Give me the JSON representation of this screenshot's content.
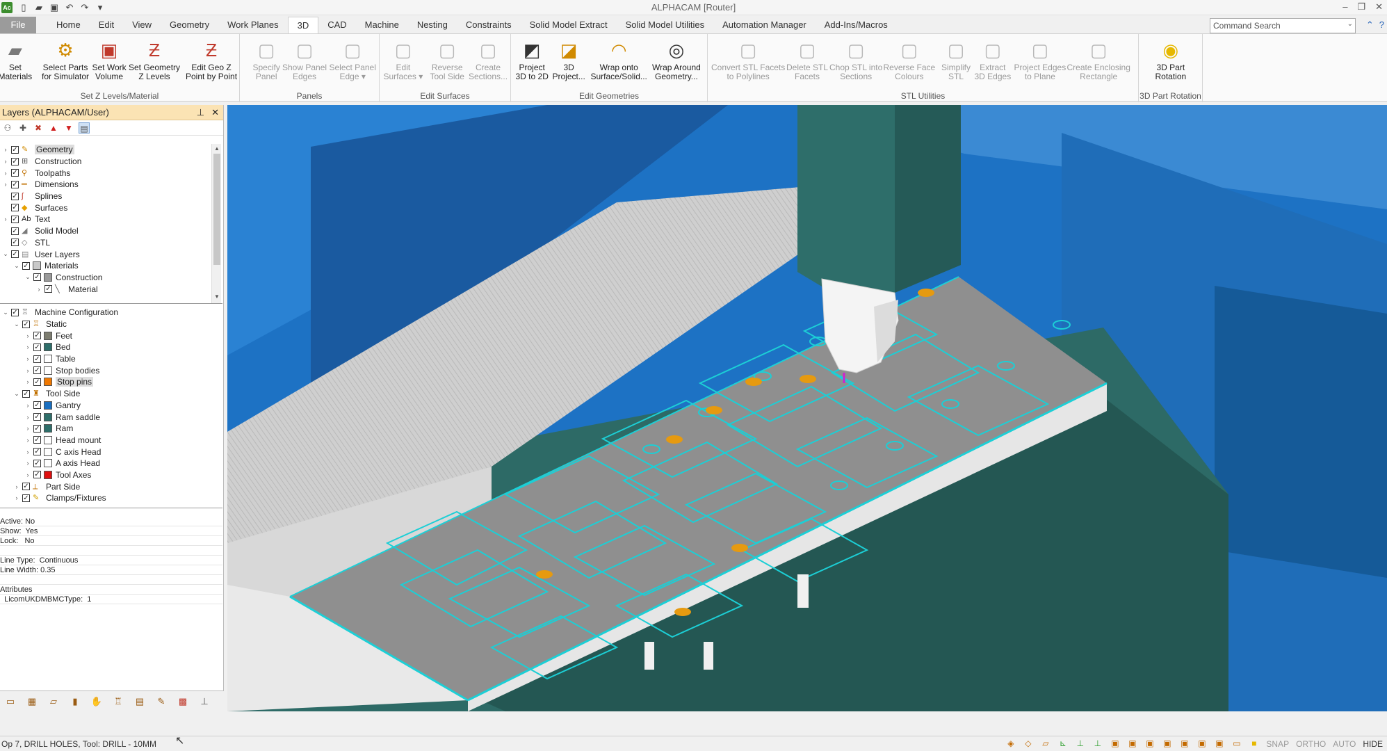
{
  "window": {
    "title": "ALPHACAM [Router]",
    "logo": "Ac"
  },
  "menu": {
    "file": "File",
    "tabs": [
      "Home",
      "Edit",
      "View",
      "Geometry",
      "Work Planes",
      "3D",
      "CAD",
      "Machine",
      "Nesting",
      "Constraints",
      "Solid Model Extract",
      "Solid Model Utilities",
      "Automation Manager",
      "Add-Ins/Macros"
    ],
    "active_tab": "3D",
    "command_search_placeholder": "Command Search"
  },
  "ribbon": {
    "groups": [
      {
        "label": "Set Z Levels/Material",
        "buttons": [
          {
            "label": "Set\nMaterials",
            "icon": "material-box-icon",
            "enabled": true
          },
          {
            "label": "Select Parts\nfor Simulator",
            "icon": "parts-simulator-icon",
            "enabled": true
          },
          {
            "label": "Set Work\nVolume",
            "icon": "work-volume-icon",
            "enabled": true
          },
          {
            "label": "Set Geometry\nZ Levels",
            "icon": "z-levels-icon",
            "enabled": true
          },
          {
            "label": "Edit Geo Z\nPoint by Point",
            "icon": "edit-z-point-icon",
            "enabled": true
          }
        ]
      },
      {
        "label": "Panels",
        "buttons": [
          {
            "label": "Specify\nPanel",
            "icon": "specify-panel-icon",
            "enabled": false
          },
          {
            "label": "Show Panel\nEdges",
            "icon": "panel-edges-icon",
            "enabled": false
          },
          {
            "label": "Select Panel\nEdge ▾",
            "icon": "select-panel-edge-icon",
            "enabled": false
          }
        ]
      },
      {
        "label": "Edit Surfaces",
        "buttons": [
          {
            "label": "Edit\nSurfaces ▾",
            "icon": "edit-surfaces-icon",
            "enabled": false
          },
          {
            "label": "Reverse\nTool Side",
            "icon": "reverse-tool-side-icon",
            "enabled": false
          },
          {
            "label": "Create\nSections...",
            "icon": "create-sections-icon",
            "enabled": false
          }
        ]
      },
      {
        "label": "Edit Geometries",
        "buttons": [
          {
            "label": "Project\n3D to 2D",
            "icon": "project-3d-2d-icon",
            "enabled": true
          },
          {
            "label": "3D\nProject...",
            "icon": "3d-project-icon",
            "enabled": true
          },
          {
            "label": "Wrap onto\nSurface/Solid...",
            "icon": "wrap-surface-icon",
            "enabled": true
          },
          {
            "label": "Wrap Around\nGeometry...",
            "icon": "wrap-geometry-icon",
            "enabled": true
          }
        ]
      },
      {
        "label": "STL Utilities",
        "buttons": [
          {
            "label": "Convert STL Facets\nto Polylines",
            "icon": "stl-polylines-icon",
            "enabled": false
          },
          {
            "label": "Delete STL\nFacets",
            "icon": "delete-stl-icon",
            "enabled": false
          },
          {
            "label": "Chop STL into\nSections",
            "icon": "chop-stl-icon",
            "enabled": false
          },
          {
            "label": "Reverse Face\nColours",
            "icon": "reverse-face-icon",
            "enabled": false
          },
          {
            "label": "Simplify\nSTL",
            "icon": "simplify-stl-icon",
            "enabled": false
          },
          {
            "label": "Extract\n3D Edges",
            "icon": "extract-edges-icon",
            "enabled": false
          },
          {
            "label": "Project Edges\nto Plane",
            "icon": "project-edges-icon",
            "enabled": false
          },
          {
            "label": "Create Enclosing\nRectangle",
            "icon": "enclosing-rect-icon",
            "enabled": false
          }
        ]
      },
      {
        "label": "3D Part Rotation",
        "buttons": [
          {
            "label": "3D Part\nRotation",
            "icon": "part-rotation-icon",
            "enabled": true
          }
        ]
      }
    ]
  },
  "layers_panel": {
    "title": "Layers (ALPHACAM/User)",
    "tree1": [
      {
        "label": "Geometry",
        "depth": 0,
        "exp": "›",
        "icon": "geometry-icon",
        "selected": true
      },
      {
        "label": "Construction",
        "depth": 0,
        "exp": "›",
        "icon": "construction-icon"
      },
      {
        "label": "Toolpaths",
        "depth": 0,
        "exp": "›",
        "icon": "toolpaths-icon"
      },
      {
        "label": "Dimensions",
        "depth": 0,
        "exp": "›",
        "icon": "dimensions-icon"
      },
      {
        "label": "Splines",
        "depth": 0,
        "exp": "",
        "icon": "splines-icon"
      },
      {
        "label": "Surfaces",
        "depth": 0,
        "exp": "",
        "icon": "surfaces-icon"
      },
      {
        "label": "Text",
        "depth": 0,
        "exp": "›",
        "icon": "text-icon"
      },
      {
        "label": "Solid Model",
        "depth": 0,
        "exp": "",
        "icon": "solid-model-icon"
      },
      {
        "label": "STL",
        "depth": 0,
        "exp": "",
        "icon": "stl-icon"
      },
      {
        "label": "User Layers",
        "depth": 0,
        "exp": "⌄",
        "icon": "user-layers-icon"
      },
      {
        "label": "Materials",
        "depth": 1,
        "exp": "⌄",
        "swatch": "#c8c8c8"
      },
      {
        "label": "Construction",
        "depth": 2,
        "exp": "⌄",
        "swatch": "#9a9a9a"
      },
      {
        "label": "Material",
        "depth": 3,
        "exp": "›",
        "icon": "line-icon"
      }
    ],
    "tree2": [
      {
        "label": "Machine Configuration",
        "depth": 0,
        "exp": "⌄",
        "icon": "machine-config-icon"
      },
      {
        "label": "Static",
        "depth": 1,
        "exp": "⌄",
        "icon": "static-icon"
      },
      {
        "label": "Feet",
        "depth": 2,
        "exp": "›",
        "swatch": "#7d7d70"
      },
      {
        "label": "Bed",
        "depth": 2,
        "exp": "›",
        "swatch": "#2e6e6a"
      },
      {
        "label": "Table",
        "depth": 2,
        "exp": "›",
        "swatch": "#ffffff"
      },
      {
        "label": "Stop bodies",
        "depth": 2,
        "exp": "›",
        "swatch": "#ffffff"
      },
      {
        "label": "Stop pins",
        "depth": 2,
        "exp": "›",
        "swatch": "#f07800",
        "selected": true
      },
      {
        "label": "Tool Side",
        "depth": 1,
        "exp": "⌄",
        "icon": "tool-side-icon"
      },
      {
        "label": "Gantry",
        "depth": 2,
        "exp": "›",
        "swatch": "#1a6fc0"
      },
      {
        "label": "Ram saddle",
        "depth": 2,
        "exp": "›",
        "swatch": "#2e6e6a"
      },
      {
        "label": "Ram",
        "depth": 2,
        "exp": "›",
        "swatch": "#2e6e6a"
      },
      {
        "label": "Head mount",
        "depth": 2,
        "exp": "›",
        "swatch": "#ffffff"
      },
      {
        "label": "C axis Head",
        "depth": 2,
        "exp": "›",
        "swatch": "#ffffff"
      },
      {
        "label": "A axis Head",
        "depth": 2,
        "exp": "›",
        "swatch": "#ffffff"
      },
      {
        "label": "Tool Axes",
        "depth": 2,
        "exp": "›",
        "swatch": "#e01010"
      },
      {
        "label": "Part Side",
        "depth": 1,
        "exp": "›",
        "icon": "part-side-icon"
      },
      {
        "label": "Clamps/Fixtures",
        "depth": 1,
        "exp": "›",
        "icon": "clamps-icon"
      }
    ],
    "properties": [
      "Active: No",
      "Show:  Yes",
      "Lock:   No",
      "",
      "Line Type:  Continuous",
      "Line Width: 0.35",
      "",
      "Attributes",
      "  LicomUKDMBMCType:  1"
    ]
  },
  "status": {
    "text": "Op 7, DRILL HOLES, Tool: DRILL - 10MM",
    "modes": [
      "SNAP",
      "ORTHO",
      "AUTO",
      "HIDE"
    ]
  },
  "colors": {
    "accent_tab": "#3c8d2e",
    "panel_header": "#fbe3b4",
    "viewport_blue": "#1a6fc0",
    "machine_teal": "#2e6e6a",
    "toolpath_cyan": "#1ccfd6",
    "stop_pins": "#f07800"
  }
}
